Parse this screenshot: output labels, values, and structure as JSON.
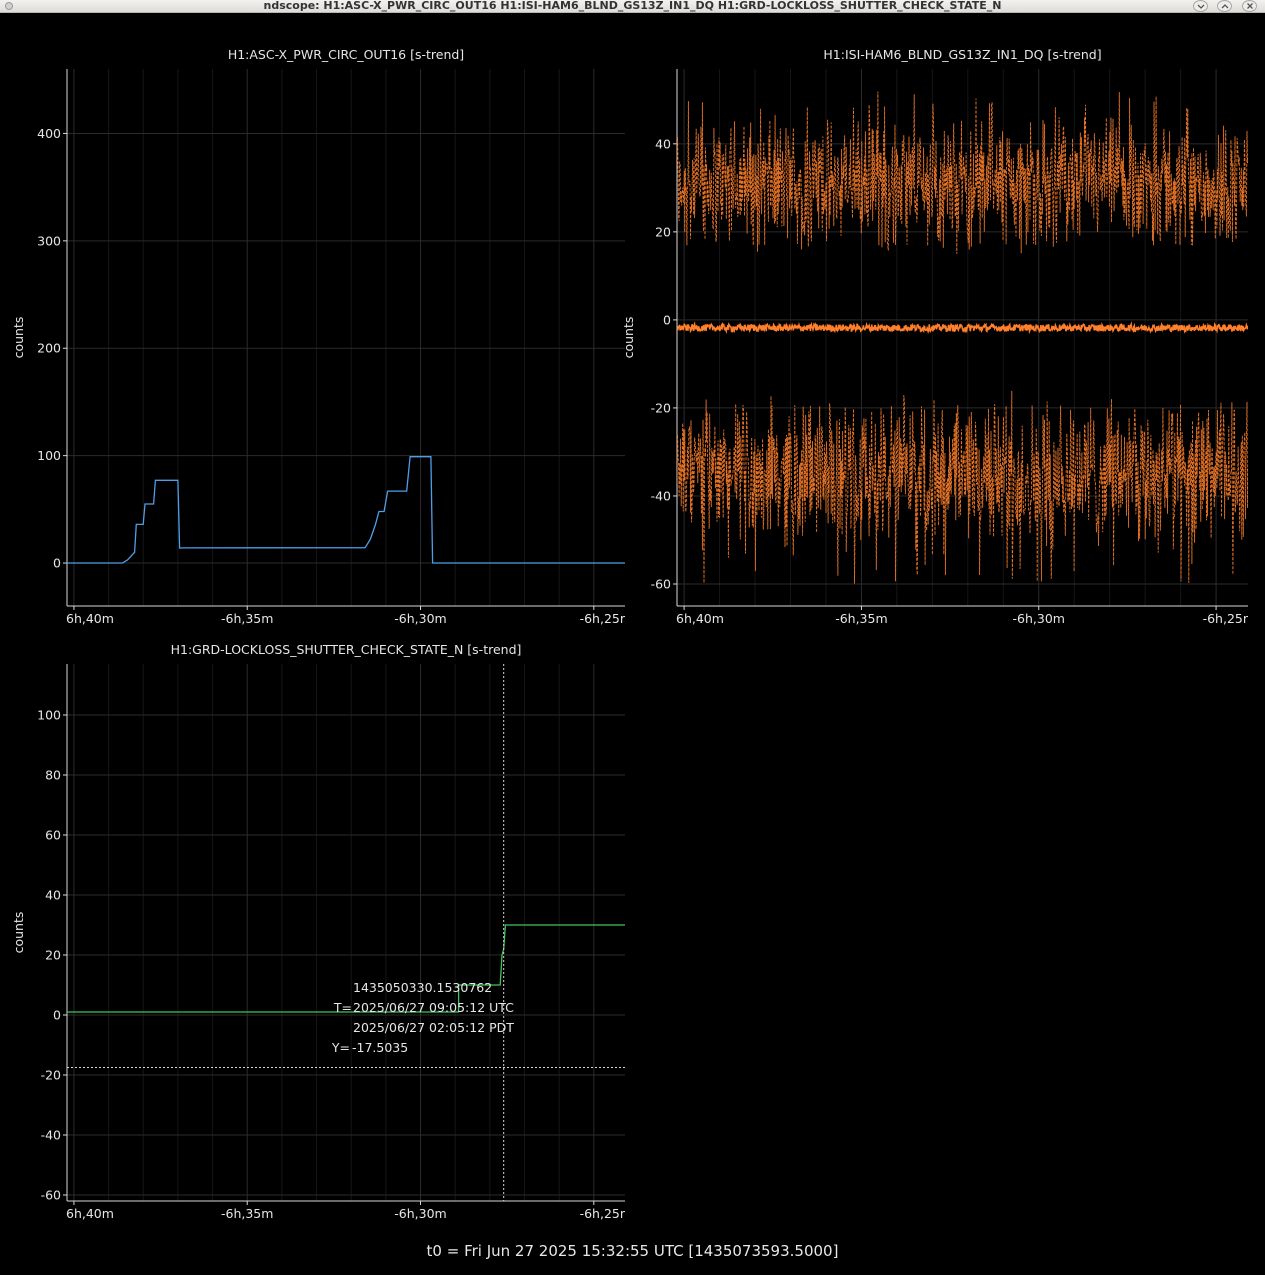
{
  "window": {
    "title": "ndscope: H1:ASC-X_PWR_CIRC_OUT16 H1:ISI-HAM6_BLND_GS13Z_IN1_DQ H1:GRD-LOCKLOSS_SHUTTER_CHECK_STATE_N",
    "buttons": [
      "minimize-icon",
      "maximize-icon",
      "close-icon"
    ]
  },
  "footer": {
    "t0": "t0 = Fri Jun 27 2025 15:32:55 UTC [1435073593.5000]"
  },
  "colors": {
    "background": "#000000",
    "axis": "#d8d8d8",
    "grid": "#2b2b2b",
    "asc_trace": "#4f9fe8",
    "isi_trace": "#ff7f2a",
    "grd_trace": "#3fc55a",
    "cursor": "#d8d8d8"
  },
  "chart_data": [
    {
      "type": "line",
      "title": "H1:ASC-X_PWR_CIRC_OUT16 [s-trend]",
      "ylabel": "counts",
      "xlabel": "",
      "xlim": [
        -40.2,
        -24.1
      ],
      "ylim": [
        -40,
        460
      ],
      "xticks": [
        -40,
        -35,
        -30,
        -25
      ],
      "xtick_labels": [
        "6h,40m",
        "-6h,35m",
        "-6h,30m",
        "-6h,25r"
      ],
      "yticks": [
        0,
        100,
        200,
        300,
        400
      ],
      "ytick_labels": [
        "0",
        "100",
        "200",
        "300",
        "400"
      ],
      "grid": true,
      "color": "#4f9fe8",
      "series": [
        {
          "x": [
            -40.2,
            -38.6,
            -38.45,
            -38.25,
            -38.2,
            -38.0,
            -37.95,
            -37.7,
            -37.65,
            -37.0,
            -36.95,
            -36.85,
            -31.6,
            -31.45,
            -31.3,
            -31.2,
            -31.05,
            -30.95,
            -30.4,
            -30.3,
            -29.7,
            -29.65,
            -29.4,
            -29.35,
            -24.1
          ],
          "y": [
            0,
            0,
            3,
            10,
            36,
            36,
            55,
            55,
            77,
            77,
            14,
            14,
            14,
            22,
            36,
            48,
            48,
            67,
            67,
            99,
            99,
            0,
            0,
            0,
            0
          ]
        }
      ]
    },
    {
      "type": "line",
      "title": "H1:ISI-HAM6_BLND_GS13Z_IN1_DQ [s-trend]",
      "ylabel": "counts",
      "xlabel": "",
      "xlim": [
        -40.2,
        -24.1
      ],
      "ylim": [
        -65,
        57
      ],
      "xticks": [
        -40,
        -35,
        -30,
        -25
      ],
      "xtick_labels": [
        "6h,40m",
        "-6h,35m",
        "-6h,30m",
        "-6h,25r"
      ],
      "yticks": [
        -60,
        -40,
        -20,
        0,
        20,
        40
      ],
      "ytick_labels": [
        "-60",
        "-40",
        "-20",
        "0",
        "20",
        "40"
      ],
      "grid": true,
      "color": "#ff7f2a",
      "series": [
        {
          "name": "",
          "style": "dashed",
          "band_center": 31,
          "band_min": 18,
          "band_max": 52
        },
        {
          "name": "",
          "style": "solid",
          "band_center": -1.8,
          "band_min": -2.6,
          "band_max": -1
        },
        {
          "name": "",
          "style": "dashed",
          "band_center": -35,
          "band_min": -60,
          "band_max": -21
        }
      ]
    },
    {
      "type": "line",
      "title": "H1:GRD-LOCKLOSS_SHUTTER_CHECK_STATE_N [s-trend]",
      "ylabel": "counts",
      "xlabel": "",
      "xlim": [
        -40.2,
        -24.1
      ],
      "ylim": [
        -62,
        117
      ],
      "xticks": [
        -40,
        -35,
        -30,
        -25
      ],
      "xtick_labels": [
        "6h,40m",
        "-6h,35m",
        "-6h,30m",
        "-6h,25r"
      ],
      "yticks": [
        -60,
        -40,
        -20,
        0,
        20,
        40,
        60,
        80,
        100
      ],
      "ytick_labels": [
        "-60",
        "-40",
        "-20",
        "0",
        "20",
        "40",
        "60",
        "80",
        "100"
      ],
      "grid": true,
      "color": "#3fc55a",
      "series": [
        {
          "x": [
            -40.2,
            -28.95,
            -28.9,
            -28.9,
            -27.7,
            -27.65,
            -27.6,
            -27.55,
            -24.1
          ],
          "y": [
            1,
            1,
            1,
            10,
            10,
            20,
            22,
            30,
            30
          ]
        }
      ],
      "cursor": {
        "x": -27.6,
        "y": -17.5035,
        "gps": "1435050330.1530762",
        "t_label": "T=",
        "utc": "2025/06/27 09:05:12 UTC",
        "pdt": "2025/06/27 02:05:12 PDT",
        "y_label": "Y=",
        "y_value": "-17.5035"
      }
    }
  ]
}
